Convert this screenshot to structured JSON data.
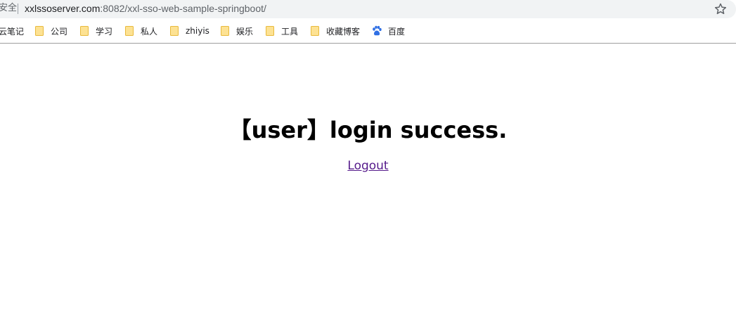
{
  "browser": {
    "security_label": "安全",
    "url_host": "xxlssoserver.com",
    "url_rest": ":8082/xxl-sso-web-sample-springboot/"
  },
  "bookmarks": [
    {
      "label": "云笔记",
      "icon": "none"
    },
    {
      "label": "公司",
      "icon": "folder-icon"
    },
    {
      "label": "学习",
      "icon": "folder-icon"
    },
    {
      "label": "私人",
      "icon": "folder-icon"
    },
    {
      "label": "zhiyis",
      "icon": "folder-icon"
    },
    {
      "label": "娱乐",
      "icon": "folder-icon"
    },
    {
      "label": "工具",
      "icon": "folder-icon"
    },
    {
      "label": "收藏博客",
      "icon": "folder-icon"
    },
    {
      "label": "百度",
      "icon": "baidu-paw-icon"
    }
  ],
  "page": {
    "title": "【user】login success.",
    "logout_label": "Logout"
  },
  "colors": {
    "visited_link": "#551a8b",
    "folder": "#f6d57a"
  }
}
